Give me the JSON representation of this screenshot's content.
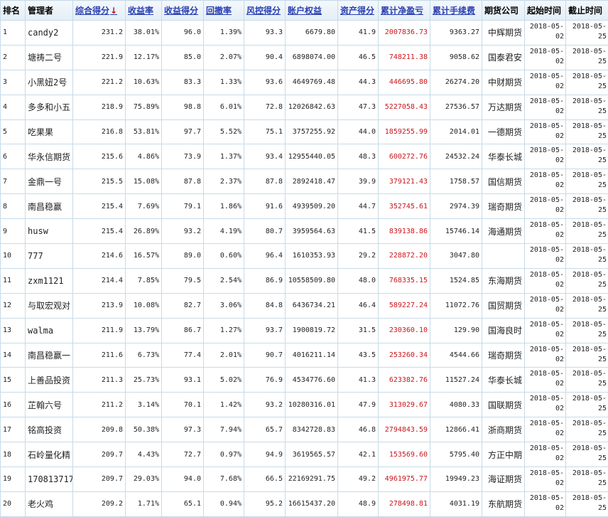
{
  "headers": {
    "rank": "排名",
    "manager": "管理者",
    "composite": "综合得分",
    "sort_arrow": "↓",
    "return_rate": "收益率",
    "return_score": "收益得分",
    "drawdown": "回撤率",
    "risk_score": "风控得分",
    "equity": "账户权益",
    "asset_score": "资产得分",
    "net_profit": "累计净盈亏",
    "fees": "累计手续费",
    "company": "期货公司",
    "start": "起始时间",
    "end": "截止时间"
  },
  "rows": [
    {
      "rank": "1",
      "manager": "candy2",
      "composite": "231.2",
      "return_rate": "38.01%",
      "return_score": "96.0",
      "drawdown": "1.39%",
      "risk_score": "93.3",
      "equity": "6679.80",
      "asset_score": "41.9",
      "net_profit": "2007836.73",
      "fees": "9363.27",
      "company": "中辉期货",
      "start": "2018-05-02",
      "end": "2018-05-25"
    },
    {
      "rank": "2",
      "manager": "塘祷二号",
      "composite": "221.9",
      "return_rate": "12.17%",
      "return_score": "85.0",
      "drawdown": "2.07%",
      "risk_score": "90.4",
      "equity": "6898074.00",
      "asset_score": "46.5",
      "net_profit": "748211.38",
      "fees": "9058.62",
      "company": "国泰君安",
      "start": "2018-05-02",
      "end": "2018-05-25"
    },
    {
      "rank": "3",
      "manager": "小黑妞2号",
      "composite": "221.2",
      "return_rate": "10.63%",
      "return_score": "83.3",
      "drawdown": "1.33%",
      "risk_score": "93.6",
      "equity": "4649769.48",
      "asset_score": "44.3",
      "net_profit": "446695.80",
      "fees": "26274.20",
      "company": "中财期货",
      "start": "2018-05-02",
      "end": "2018-05-25"
    },
    {
      "rank": "4",
      "manager": "多多和小五",
      "composite": "218.9",
      "return_rate": "75.89%",
      "return_score": "98.8",
      "drawdown": "6.01%",
      "risk_score": "72.8",
      "equity": "12026842.63",
      "asset_score": "47.3",
      "net_profit": "5227058.43",
      "fees": "27536.57",
      "company": "万达期货",
      "start": "2018-05-02",
      "end": "2018-05-25"
    },
    {
      "rank": "5",
      "manager": "吃果果",
      "composite": "216.8",
      "return_rate": "53.81%",
      "return_score": "97.7",
      "drawdown": "5.52%",
      "risk_score": "75.1",
      "equity": "3757255.92",
      "asset_score": "44.0",
      "net_profit": "1859255.99",
      "fees": "2014.01",
      "company": "一德期货",
      "start": "2018-05-02",
      "end": "2018-05-25"
    },
    {
      "rank": "6",
      "manager": "华永信期货",
      "composite": "215.6",
      "return_rate": "4.86%",
      "return_score": "73.9",
      "drawdown": "1.37%",
      "risk_score": "93.4",
      "equity": "12955440.05",
      "asset_score": "48.3",
      "net_profit": "600272.76",
      "fees": "24532.24",
      "company": "华泰长城",
      "start": "2018-05-02",
      "end": "2018-05-25"
    },
    {
      "rank": "7",
      "manager": "金鼎一号",
      "composite": "215.5",
      "return_rate": "15.08%",
      "return_score": "87.8",
      "drawdown": "2.37%",
      "risk_score": "87.8",
      "equity": "2892418.47",
      "asset_score": "39.9",
      "net_profit": "379121.43",
      "fees": "1758.57",
      "company": "国信期货",
      "start": "2018-05-02",
      "end": "2018-05-25"
    },
    {
      "rank": "8",
      "manager": "南昌稳赢",
      "composite": "215.4",
      "return_rate": "7.69%",
      "return_score": "79.1",
      "drawdown": "1.86%",
      "risk_score": "91.6",
      "equity": "4939509.20",
      "asset_score": "44.7",
      "net_profit": "352745.61",
      "fees": "2974.39",
      "company": "瑞奇期货",
      "start": "2018-05-02",
      "end": "2018-05-25"
    },
    {
      "rank": "9",
      "manager": "husw",
      "composite": "215.4",
      "return_rate": "26.89%",
      "return_score": "93.2",
      "drawdown": "4.19%",
      "risk_score": "80.7",
      "equity": "3959564.63",
      "asset_score": "41.5",
      "net_profit": "839138.86",
      "fees": "15746.14",
      "company": "海通期货",
      "start": "2018-05-02",
      "end": "2018-05-25"
    },
    {
      "rank": "10",
      "manager": "777",
      "composite": "214.6",
      "return_rate": "16.57%",
      "return_score": "89.0",
      "drawdown": "0.60%",
      "risk_score": "96.4",
      "equity": "1610353.93",
      "asset_score": "29.2",
      "net_profit": "228872.20",
      "fees": "3047.80",
      "company": "",
      "start": "2018-05-02",
      "end": "2018-05-25"
    },
    {
      "rank": "11",
      "manager": "zxm1121",
      "composite": "214.4",
      "return_rate": "7.85%",
      "return_score": "79.5",
      "drawdown": "2.54%",
      "risk_score": "86.9",
      "equity": "10558509.80",
      "asset_score": "48.0",
      "net_profit": "768335.15",
      "fees": "1524.85",
      "company": "东海期货",
      "start": "2018-05-02",
      "end": "2018-05-25"
    },
    {
      "rank": "12",
      "manager": "与取宏观对",
      "composite": "213.9",
      "return_rate": "10.08%",
      "return_score": "82.7",
      "drawdown": "3.06%",
      "risk_score": "84.8",
      "equity": "6436734.21",
      "asset_score": "46.4",
      "net_profit": "589227.24",
      "fees": "11072.76",
      "company": "国贸期货",
      "start": "2018-05-02",
      "end": "2018-05-25"
    },
    {
      "rank": "13",
      "manager": "walma",
      "composite": "211.9",
      "return_rate": "13.79%",
      "return_score": "86.7",
      "drawdown": "1.27%",
      "risk_score": "93.7",
      "equity": "1900819.72",
      "asset_score": "31.5",
      "net_profit": "230360.10",
      "fees": "129.90",
      "company": "国海良时",
      "start": "2018-05-02",
      "end": "2018-05-25"
    },
    {
      "rank": "14",
      "manager": "南昌稳赢一",
      "composite": "211.6",
      "return_rate": "6.73%",
      "return_score": "77.4",
      "drawdown": "2.01%",
      "risk_score": "90.7",
      "equity": "4016211.14",
      "asset_score": "43.5",
      "net_profit": "253260.34",
      "fees": "4544.66",
      "company": "瑞奇期货",
      "start": "2018-05-02",
      "end": "2018-05-25"
    },
    {
      "rank": "15",
      "manager": "上善品投资",
      "composite": "211.3",
      "return_rate": "25.73%",
      "return_score": "93.1",
      "drawdown": "5.02%",
      "risk_score": "76.9",
      "equity": "4534776.60",
      "asset_score": "41.3",
      "net_profit": "623382.76",
      "fees": "11527.24",
      "company": "华泰长城",
      "start": "2018-05-02",
      "end": "2018-05-25"
    },
    {
      "rank": "16",
      "manager": "芷翰六号",
      "composite": "211.2",
      "return_rate": "3.14%",
      "return_score": "70.1",
      "drawdown": "1.42%",
      "risk_score": "93.2",
      "equity": "10280316.01",
      "asset_score": "47.9",
      "net_profit": "313029.67",
      "fees": "4080.33",
      "company": "国联期货",
      "start": "2018-05-02",
      "end": "2018-05-25"
    },
    {
      "rank": "17",
      "manager": "铭高投资",
      "composite": "209.8",
      "return_rate": "50.38%",
      "return_score": "97.3",
      "drawdown": "7.94%",
      "risk_score": "65.7",
      "equity": "8342728.83",
      "asset_score": "46.8",
      "net_profit": "2794843.59",
      "fees": "12866.41",
      "company": "浙商期货",
      "start": "2018-05-02",
      "end": "2018-05-25"
    },
    {
      "rank": "18",
      "manager": "石岭量化精",
      "composite": "209.7",
      "return_rate": "4.43%",
      "return_score": "72.7",
      "drawdown": "0.97%",
      "risk_score": "94.9",
      "equity": "3619565.57",
      "asset_score": "42.1",
      "net_profit": "153569.60",
      "fees": "5795.40",
      "company": "方正中期",
      "start": "2018-05-02",
      "end": "2018-05-25"
    },
    {
      "rank": "19",
      "manager": "170813717",
      "composite": "209.7",
      "return_rate": "29.03%",
      "return_score": "94.0",
      "drawdown": "7.68%",
      "risk_score": "66.5",
      "equity": "22169291.75",
      "asset_score": "49.2",
      "net_profit": "4961975.77",
      "fees": "19949.23",
      "company": "海证期货",
      "start": "2018-05-02",
      "end": "2018-05-25"
    },
    {
      "rank": "20",
      "manager": "老火鸡",
      "composite": "209.2",
      "return_rate": "1.71%",
      "return_score": "65.1",
      "drawdown": "0.94%",
      "risk_score": "95.2",
      "equity": "16615437.20",
      "asset_score": "48.9",
      "net_profit": "278498.81",
      "fees": "4031.19",
      "company": "东航期货",
      "start": "2018-05-02",
      "end": "2018-05-25"
    }
  ]
}
